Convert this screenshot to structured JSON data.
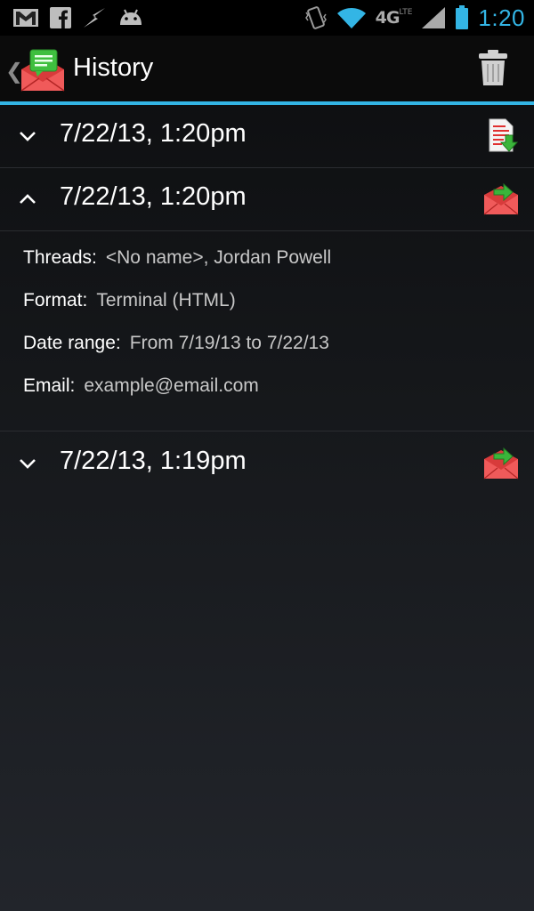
{
  "status_bar": {
    "time": "1:20",
    "network": "4G",
    "network_sub": "LTE",
    "icons": [
      "gmail-icon",
      "facebook-icon",
      "flash-icon",
      "android-icon",
      "vibrate-icon",
      "wifi-icon",
      "signal-icon",
      "battery-icon"
    ],
    "accent": "#33b5e5"
  },
  "action_bar": {
    "title": "History",
    "delete_icon": "trash-icon"
  },
  "history": {
    "items": [
      {
        "date": "7/22/13, 1:20pm",
        "expanded": false,
        "icon": "file-download-icon"
      },
      {
        "date": "7/22/13, 1:20pm",
        "expanded": true,
        "icon": "email-send-icon"
      },
      {
        "date": "7/22/13, 1:19pm",
        "expanded": false,
        "icon": "email-send-icon"
      }
    ],
    "details": {
      "threads_label": "Threads:",
      "threads_value": "<No name>, Jordan Powell",
      "format_label": "Format:",
      "format_value": "Terminal (HTML)",
      "date_range_label": "Date range:",
      "date_range_value": "From 7/19/13 to 7/22/13",
      "email_label": "Email:",
      "email_value": "example@email.com"
    }
  }
}
